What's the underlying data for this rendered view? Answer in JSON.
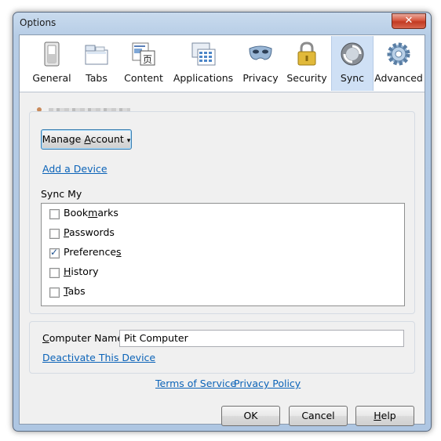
{
  "window": {
    "title": "Options",
    "close_glyph": "✕"
  },
  "toolbar": {
    "tabs": [
      {
        "label": "General",
        "icon": "switch-icon"
      },
      {
        "label": "Tabs",
        "icon": "tabs-icon"
      },
      {
        "label": "Content",
        "icon": "content-icon"
      },
      {
        "label": "Applications",
        "icon": "applications-icon"
      },
      {
        "label": "Privacy",
        "icon": "mask-icon"
      },
      {
        "label": "Security",
        "icon": "padlock-icon"
      },
      {
        "label": "Sync",
        "icon": "sync-icon",
        "selected": true
      },
      {
        "label": "Advanced",
        "icon": "gear-icon"
      }
    ]
  },
  "account": {
    "manage_button": {
      "label": "Manage Account",
      "accesskey_index": 7,
      "arrow": "▾"
    },
    "add_device_link": "Add a Device"
  },
  "sync_my": {
    "heading": "Sync My",
    "items": [
      {
        "label": "Bookmarks",
        "checked": false,
        "accesskey_index": 4
      },
      {
        "label": "Passwords",
        "checked": false,
        "accesskey_index": 0
      },
      {
        "label": "Preferences",
        "checked": true,
        "accesskey_index": 9
      },
      {
        "label": "History",
        "checked": false,
        "accesskey_index": 0
      },
      {
        "label": "Tabs",
        "checked": false,
        "accesskey_index": 0
      }
    ]
  },
  "device": {
    "computer_name_label": "Computer Name:",
    "computer_name_value": "Pit Computer",
    "deactivate_link": "Deactivate This Device"
  },
  "links": {
    "terms": "Terms of Service",
    "privacy": "Privacy Policy"
  },
  "buttons": {
    "ok": "OK",
    "cancel": "Cancel",
    "help": "Help"
  },
  "colors": {
    "accent": "#0b63b8",
    "selected_tab": "#cfe0f5",
    "close": "#c23a22"
  }
}
